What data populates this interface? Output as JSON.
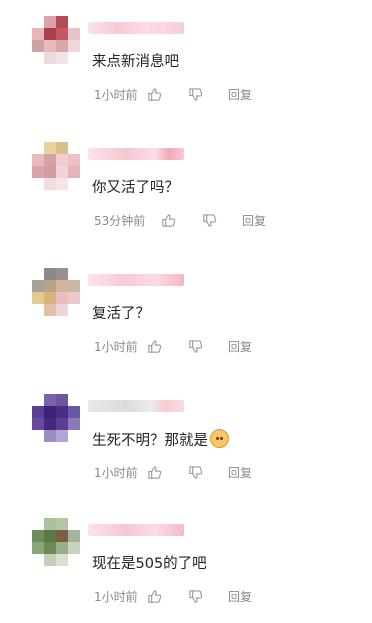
{
  "comments": [
    {
      "text": "来点新消息吧",
      "time": "1小时前",
      "reply_label": "回复",
      "emoji": ""
    },
    {
      "text": "你又活了吗？",
      "time": "53分钟前",
      "reply_label": "回复",
      "emoji": ""
    },
    {
      "text": "复活了？",
      "time": "1小时前",
      "reply_label": "回复",
      "emoji": ""
    },
    {
      "text": "生死不明？那就是",
      "time": "1小时前",
      "reply_label": "回复",
      "emoji": "doge-emoji"
    },
    {
      "text": "现在是505的了吧",
      "time": "1小时前",
      "reply_label": "回复",
      "emoji": ""
    }
  ],
  "icons": {
    "like": "thumbs-up-icon",
    "dislike": "thumbs-down-icon"
  },
  "colors": {
    "text": "#222222",
    "meta": "#8a8a8a",
    "icon": "#9a9a9a"
  }
}
